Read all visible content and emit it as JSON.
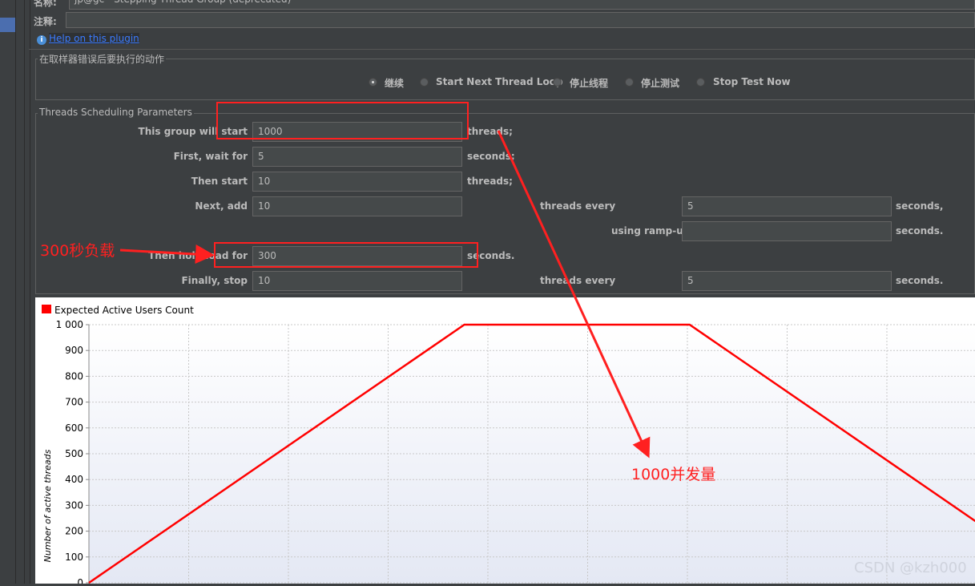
{
  "form": {
    "name_label": "名称:",
    "name_value": "jp@gc - Stepping Thread Group (deprecated)",
    "comment_label": "注释:",
    "help_link": "Help on this plugin"
  },
  "error_action": {
    "title": "在取样器错误后要执行的动作",
    "options": [
      "继续",
      "Start Next Thread Loop",
      "停止线程",
      "停止测试",
      "Stop Test Now"
    ],
    "selected": "继续"
  },
  "scheduling": {
    "title": "Threads Scheduling Parameters",
    "start_label": "This group will start",
    "start_value": "1000",
    "start_unit": "threads;",
    "wait_label": "First, wait for",
    "wait_value": "5",
    "wait_unit": "seconds;",
    "then_start_label": "Then start",
    "then_start_value": "10",
    "then_start_unit": "threads;",
    "next_add_label": "Next, add",
    "next_add_value": "10",
    "next_add_every_label": "threads every",
    "next_add_every_value": "5",
    "next_add_every_unit": "seconds,",
    "rampup_label": "using ramp-up",
    "rampup_value": "",
    "rampup_unit": "seconds.",
    "hold_label": "Then hold load for",
    "hold_value": "300",
    "hold_unit": "seconds.",
    "stop_label": "Finally, stop",
    "stop_value": "10",
    "stop_every_label": "threads every",
    "stop_every_value": "5",
    "stop_every_unit": "seconds."
  },
  "annotations": {
    "hold_note": "300秒负载",
    "users_note": "1000并发量",
    "annotation_color": "#ff2020"
  },
  "watermark": "CSDN @kzh000",
  "chart_data": {
    "type": "line",
    "series": [
      {
        "name": "Expected Active Users Count",
        "color": "#ff0000",
        "points": [
          [
            0,
            0
          ],
          [
            500,
            1000
          ],
          [
            800,
            1000
          ],
          [
            1100,
            400
          ],
          [
            1300,
            0
          ]
        ]
      }
    ],
    "x_range": [
      0,
      1300
    ],
    "x_visible_max": 1180,
    "ylim": [
      0,
      1000
    ],
    "yticks": [
      "0",
      "100",
      "200",
      "300",
      "400",
      "500",
      "600",
      "700",
      "800",
      "900",
      "1 000"
    ],
    "ylabel": "Number of active threads",
    "grid": true,
    "legend": "top-left"
  }
}
